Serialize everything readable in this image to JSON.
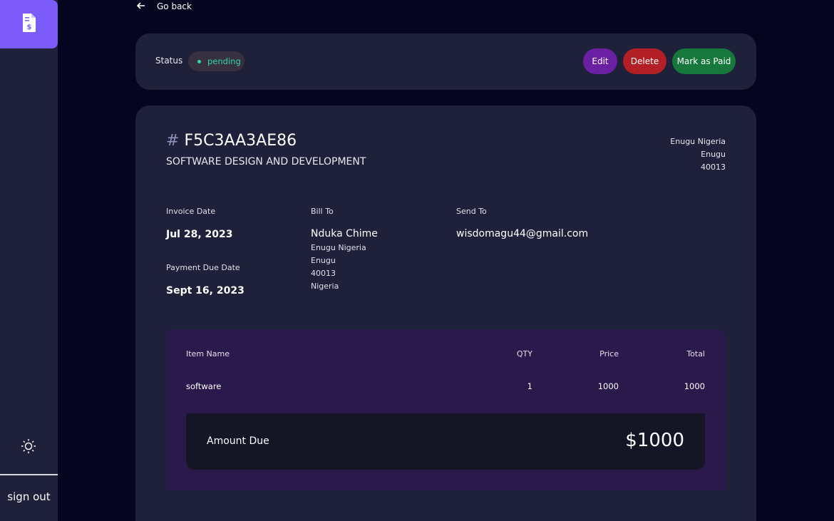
{
  "sidebar": {
    "logo_icon": "invoice-icon",
    "theme_icon": "sun-icon",
    "signout_label": "sign out"
  },
  "nav": {
    "go_back_label": "Go back"
  },
  "status_bar": {
    "label": "Status",
    "status": "pending",
    "edit_label": "Edit",
    "delete_label": "Delete",
    "mark_paid_label": "Mark as Paid"
  },
  "invoice": {
    "hash": "#",
    "id": "F5C3AA3AE86",
    "description": "SOFTWARE DESIGN AND DEVELOPMENT",
    "sender_address": [
      "Enugu Nigeria",
      "Enugu",
      "40013"
    ],
    "invoice_date_label": "Invoice Date",
    "invoice_date": "Jul 28, 2023",
    "due_date_label": "Payment Due Date",
    "due_date": "Sept 16, 2023",
    "bill_to_label": "Bill To",
    "client_name": "Nduka Chime",
    "client_address": [
      "Enugu Nigeria",
      "Enugu",
      "40013",
      "Nigeria"
    ],
    "send_to_label": "Send To",
    "client_email": "wisdomagu44@gmail.com"
  },
  "items": {
    "headers": {
      "name": "Item Name",
      "qty": "QTY",
      "price": "Price",
      "total": "Total"
    },
    "rows": [
      {
        "name": "software",
        "qty": "1",
        "price": "1000",
        "total": "1000"
      }
    ],
    "amount_due_label": "Amount Due",
    "amount_due": "$1000"
  },
  "colors": {
    "accent": "#7b5cfa",
    "pending": "#33d69f",
    "edit": "#6b1fa3",
    "delete": "#b21f24",
    "paid": "#16783a"
  }
}
